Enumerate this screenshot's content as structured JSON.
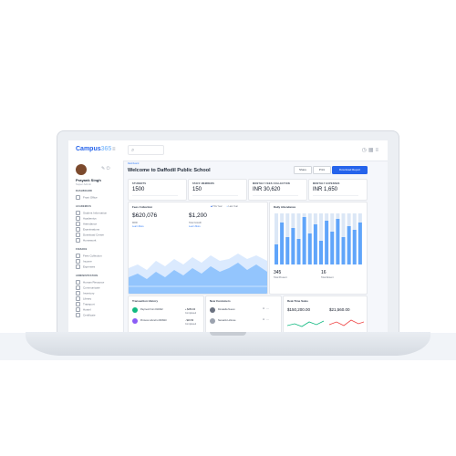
{
  "app": {
    "logo_main": "Campus",
    "logo_accent": "365"
  },
  "topbar": {
    "search_icon": "search-icon"
  },
  "profile": {
    "name": "Prayank Singh",
    "role": "Super Admin"
  },
  "sidebar": {
    "sections": [
      {
        "title": "DASHBOARD",
        "items": [
          "Front Office"
        ]
      },
      {
        "title": "ACADEMICS",
        "items": [
          "Student Information",
          "Academics",
          "Attendance",
          "Examinations",
          "Download Center",
          "Homework"
        ]
      },
      {
        "title": "FINANCE",
        "items": [
          "Fees Collection",
          "Income",
          "Expenses"
        ]
      },
      {
        "title": "ADMINISTRATION",
        "items": [
          "Human Resource",
          "Communicate",
          "Inventory",
          "Library",
          "Transport",
          "Hostel",
          "Certificate"
        ]
      }
    ]
  },
  "header": {
    "breadcrumb": "Dashboard",
    "title": "Welcome to Daffodil Public School",
    "buttons": [
      "Share",
      "Print",
      "Download Report"
    ]
  },
  "stats": [
    {
      "label": "STUDENTS",
      "value": "1500"
    },
    {
      "label": "STAFF MEMBERS",
      "value": "150"
    },
    {
      "label": "MONTHLY FEES COLLECTION",
      "value": "INR 30,620"
    },
    {
      "label": "MONTHLY EXPENSES",
      "value": "INR 1,650"
    }
  ],
  "fees_collection": {
    "title": "Fees Collection",
    "value1": "$620,076",
    "value1_label": "MRR",
    "value2": "$1,200",
    "value2_label": "Total Growth",
    "link": "Learn More",
    "legend": [
      "This Year",
      "Last Year"
    ]
  },
  "daily_attendance": {
    "title": "Daily Attendance",
    "value1": "345",
    "value1_label": "Total Present",
    "value2": "16",
    "value2_label": "Total Absent",
    "colors": {
      "present": "#60a5fa",
      "absent": "#dbe7f6"
    }
  },
  "transaction_history": {
    "title": "Transaction History",
    "rows": [
      {
        "name": "Payment from #10322",
        "amount": "+ $250.00",
        "status": "Completed",
        "color": "#10b981"
      },
      {
        "name": "Process refund to #00910",
        "amount": "- $16.50",
        "status": "Completed",
        "color": "#8b5cf6"
      }
    ]
  },
  "new_customers": {
    "title": "New Customers",
    "rows": [
      {
        "name": "Donatella Nuevo",
        "color": "#6b7280"
      },
      {
        "name": "Nessaris Lobrese",
        "color": "#9ca3af"
      }
    ]
  },
  "real_time_sales": {
    "title": "Real-Time Sales",
    "value1": "$150,200.00",
    "value2": "$21,560.00"
  }
}
